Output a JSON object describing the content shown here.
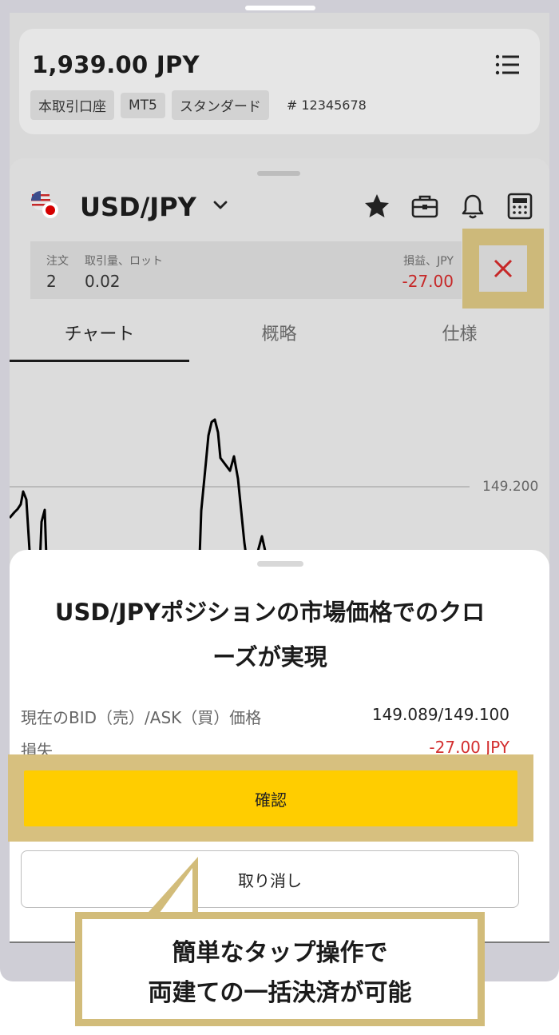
{
  "account": {
    "balance": "1,939.00 JPY",
    "tags": [
      "本取引口座",
      "MT5",
      "スタンダード"
    ],
    "account_number": "# 12345678"
  },
  "instrument": {
    "symbol": "USD/JPY",
    "header_icons": [
      "star-icon",
      "briefcase-icon",
      "bell-icon",
      "calculator-icon"
    ]
  },
  "position": {
    "orders_label": "注文",
    "orders_value": "2",
    "volume_label": "取引量、ロット",
    "volume_value": "0.02",
    "pnl_label": "損益、JPY",
    "pnl_value": "-27.00"
  },
  "tabs": [
    {
      "label": "チャート",
      "active": true
    },
    {
      "label": "概略",
      "active": false
    },
    {
      "label": "仕様",
      "active": false
    }
  ],
  "chart": {
    "price_level": "149.200"
  },
  "dialog": {
    "title_line1": "USD/JPYポジションの市場価格でのクロ",
    "title_line2": "ーズが実現",
    "bid_ask_label": "現在のBID（売）/ASK（買）価格",
    "bid_ask_value": "149.089/149.100",
    "loss_label": "損失",
    "loss_value": "-27.00 JPY",
    "confirm_label": "確認",
    "cancel_label": "取り消し"
  },
  "callout": {
    "line1": "簡単なタップ操作で",
    "line2": "両建ての一括決済が可能"
  },
  "colors": {
    "accent_yellow": "#ffcd00",
    "highlight_gold": "#d2bc7a",
    "negative_red": "#d32f2f"
  }
}
